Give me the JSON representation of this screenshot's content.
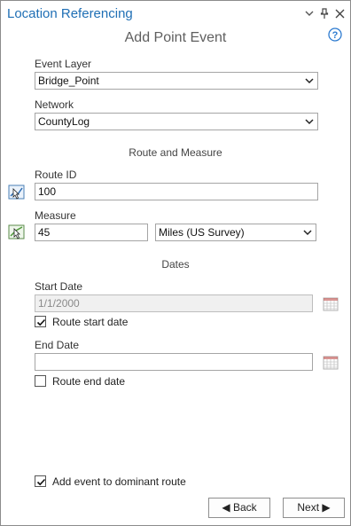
{
  "window": {
    "title": "Location Referencing",
    "subtitle": "Add Point Event"
  },
  "event_layer": {
    "label": "Event Layer",
    "value": "Bridge_Point"
  },
  "network": {
    "label": "Network",
    "value": "CountyLog"
  },
  "route_measure": {
    "heading": "Route and Measure",
    "route_id_label": "Route ID",
    "route_id_value": "100",
    "measure_label": "Measure",
    "measure_value": "45",
    "units_value": "Miles (US Survey)"
  },
  "dates": {
    "heading": "Dates",
    "start_label": "Start Date",
    "start_value": "1/1/2000",
    "route_start_label": "Route start date",
    "route_start_checked": true,
    "end_label": "End Date",
    "end_value": "",
    "route_end_label": "Route end date",
    "route_end_checked": false
  },
  "footer": {
    "dominant_label": "Add event to dominant route",
    "dominant_checked": true,
    "back_label": "◀ Back",
    "next_label": "Next ▶"
  }
}
